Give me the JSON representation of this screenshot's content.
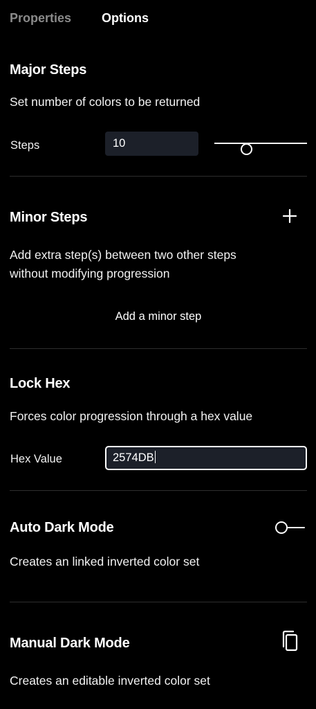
{
  "tabs": [
    {
      "label": "Properties",
      "active": false
    },
    {
      "label": "Options",
      "active": true
    }
  ],
  "major_steps": {
    "title": "Major Steps",
    "description": "Set number of colors to be returned",
    "steps_label": "Steps",
    "steps_value": "10",
    "slider_level": 0.35
  },
  "minor_steps": {
    "title": "Minor Steps",
    "add_icon": "plus-icon",
    "description_line1": "Add extra step(s) between two other steps",
    "description_line2": "without modifying progression",
    "add_button_label": "Add a minor step"
  },
  "lock_hex": {
    "title": "Lock Hex",
    "description": "Forces color progression through a hex value",
    "hex_label": "Hex Value",
    "hex_value": "2574DB"
  },
  "auto_dark_mode": {
    "title": "Auto Dark Mode",
    "toggle_icon": "toggle-off-icon",
    "enabled": false,
    "description": "Creates an linked inverted color set"
  },
  "manual_dark_mode": {
    "title": "Manual Dark Mode",
    "copy_icon": "copy-icon",
    "description": "Creates an editable inverted color set"
  },
  "colors": {
    "background": "#000000",
    "text": "#ffffff",
    "muted_text": "#8a8a8a",
    "input_background": "#1c2029",
    "divider": "#2e2e2e"
  }
}
